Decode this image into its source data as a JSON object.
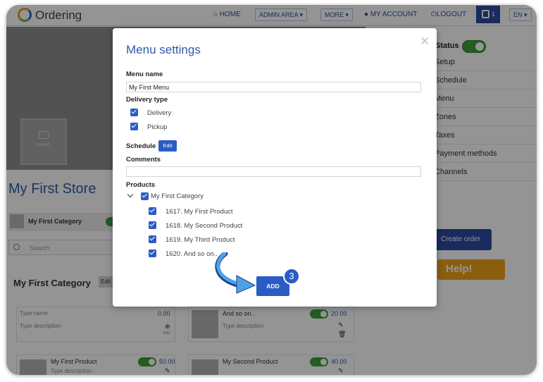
{
  "navbar": {
    "brand": "Ordering",
    "home": "HOME",
    "admin_area": "ADMIN AREA",
    "more": "MORE",
    "my_account": "MY ACCOUNT",
    "logout": "LOGOUT",
    "cart_count": "1",
    "language": "EN"
  },
  "background": {
    "hero_thumb_label": "Upload",
    "store_title": "My First Store",
    "category_strip_label": "My First Category",
    "search_placeholder": "Search",
    "section_title": "My First Category",
    "section_edit": "Edit",
    "new_product": {
      "name_placeholder": "Type name",
      "price": "0.00",
      "description_placeholder": "Type description",
      "add_label": "Add"
    },
    "product_cards": [
      {
        "name": "And so on..",
        "price": "20.00",
        "description_placeholder": "Type description"
      },
      {
        "name": "My First Product",
        "price": "50.00",
        "description_placeholder": "Type description"
      },
      {
        "name": "My Second Product",
        "price": "40.00",
        "description_placeholder": ""
      }
    ],
    "sidebar": {
      "status_label": "Status",
      "rows": [
        "Setup",
        "Schedule",
        "Menu",
        "Zones",
        "Taxes",
        "Payment methods",
        "Channels"
      ],
      "create_order": "Create order",
      "help": "Help!"
    }
  },
  "modal": {
    "title": "Menu settings",
    "menu_name_label": "Menu name",
    "menu_name_value": "My First Menu",
    "delivery_type_label": "Delivery type",
    "delivery_options": [
      {
        "label": "Delivery",
        "checked": true
      },
      {
        "label": "Pickup",
        "checked": true
      }
    ],
    "schedule_label": "Schedule",
    "schedule_edit": "Edit",
    "comments_label": "Comments",
    "comments_value": "",
    "products_label": "Products",
    "category": {
      "label": "My First Category",
      "checked": true
    },
    "products": [
      {
        "label": "1617. My First Product",
        "checked": true
      },
      {
        "label": "1618. My Second Product",
        "checked": true
      },
      {
        "label": "1619. My Third Product",
        "checked": true
      },
      {
        "label": "1620. And so on..",
        "checked": true
      }
    ],
    "add_button": "ADD",
    "step_badge": "3"
  },
  "colors": {
    "brand_blue": "#2b5cc4",
    "navy": "#2b4aa3",
    "toggle_green": "#3f9f3a",
    "help_orange": "#f0a31a",
    "title_blue": "#2e5aa8"
  }
}
